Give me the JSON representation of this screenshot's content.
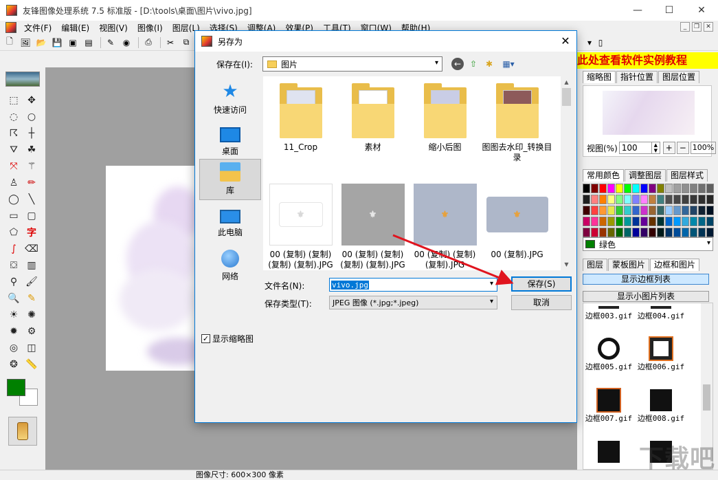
{
  "window": {
    "title": "友锋图像处理系统 7.5 标准版 - [D:\\tools\\桌面\\图片\\vivo.jpg]",
    "minimize": "—",
    "maximize": "☐",
    "close": "✕"
  },
  "menu": [
    "文件(F)",
    "编辑(E)",
    "视图(V)",
    "图像(I)",
    "图层(L)",
    "选择(S)",
    "调整(A)",
    "效果(P)",
    "工具(T)",
    "窗口(W)",
    "帮助(H)"
  ],
  "banner": "此处查看软件实例教程",
  "right_panel": {
    "top_tabs": [
      "缩略图",
      "指针位置",
      "图层位置"
    ],
    "zoom_label": "视图(%)",
    "zoom_value": "100",
    "zoom_in": "+",
    "zoom_out": "−",
    "zoom_100": "100%",
    "color_tabs": [
      "常用颜色",
      "调整图层",
      "图层样式"
    ],
    "selected_color_name": "绿色",
    "layer_tabs": [
      "图层",
      "蒙板图片",
      "边框和图片"
    ],
    "show_border_list": "显示边框列表",
    "show_small_list": "显示小图片列表",
    "border_items": [
      "边框003.gif",
      "边框004.gif",
      "边框005.gif",
      "边框006.gif",
      "边框007.gif",
      "边框008.gif"
    ]
  },
  "status": {
    "image_size": "图像尺寸: 600×300 像素"
  },
  "dialog": {
    "title": "另存为",
    "save_in_label": "保存在(I):",
    "current_folder": "图片",
    "places": [
      "快速访问",
      "桌面",
      "库",
      "此电脑",
      "网络"
    ],
    "files": [
      {
        "name": "11_Crop",
        "kind": "folder"
      },
      {
        "name": "素材",
        "kind": "folder"
      },
      {
        "name": "缩小后图",
        "kind": "folder"
      },
      {
        "name": "图图去水印_转换目录",
        "kind": "folder"
      },
      {
        "name": "00 (复制) (复制) (复制) (复制).JPG",
        "kind": "image"
      },
      {
        "name": "00 (复制) (复制) (复制) (复制).JPG",
        "kind": "image"
      },
      {
        "name": "00 (复制) (复制) (复制).JPG",
        "kind": "image"
      },
      {
        "name": "00 (复制).JPG",
        "kind": "image"
      }
    ],
    "filename_label": "文件名(N):",
    "filename_value": "vivo.jpg",
    "filetype_label": "保存类型(T):",
    "filetype_value": "JPEG 图像 (*.jpg;*.jpeg)",
    "save_button": "保存(S)",
    "cancel_button": "取消",
    "show_thumbnail": "显示缩略图",
    "show_thumbnail_checked": true
  },
  "watermark": "下载吧",
  "colors": {
    "accent": "#0078d7",
    "banner_bg": "#ffff00",
    "banner_text": "#e00000",
    "arrow": "#e0141e",
    "foreground_color": "#008000"
  }
}
